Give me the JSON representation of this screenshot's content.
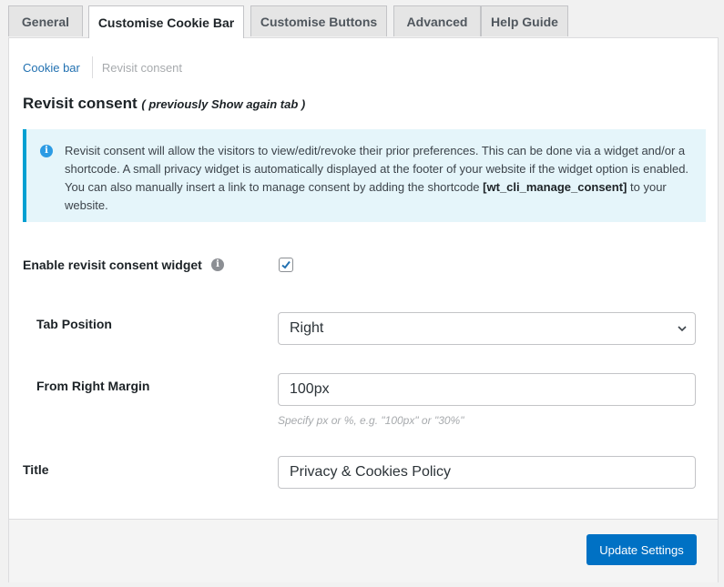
{
  "tabs": [
    {
      "label": "General",
      "active": false
    },
    {
      "label": "Customise Cookie Bar",
      "active": true
    },
    {
      "label": "Customise Buttons",
      "active": false
    },
    {
      "label": "Advanced",
      "active": false
    },
    {
      "label": "Help Guide",
      "active": false
    }
  ],
  "subnav": {
    "items": [
      {
        "label": "Cookie bar",
        "active": false
      },
      {
        "label": "Revisit consent",
        "active": true
      }
    ]
  },
  "section": {
    "title": "Revisit consent",
    "subtitle": "( previously Show again tab )"
  },
  "notice": {
    "icon": "info-icon",
    "text": "Revisit consent will allow the visitors to view/edit/revoke their prior preferences. This can be done via a widget and/or a shortcode. A small privacy widget is automatically displayed at the footer of your website if the widget option is enabled. You can also manually insert a link to manage consent by adding the shortcode",
    "shortcode": "[wt_cli_manage_consent]",
    "text_end": "to your website."
  },
  "form": {
    "enable_widget": {
      "label": "Enable revisit consent widget",
      "checked": true,
      "info_icon": "info-icon"
    },
    "tab_position": {
      "label": "Tab Position",
      "value": "Right"
    },
    "right_margin": {
      "label": "From Right Margin",
      "value": "100px",
      "hint": "Specify px or %, e.g. \"100px\" or \"30%\""
    },
    "title": {
      "label": "Title",
      "value": "Privacy & Cookies Policy"
    }
  },
  "footer": {
    "update_label": "Update Settings"
  },
  "colors": {
    "primary": "#0071c4",
    "link": "#2271b1",
    "notice_bg": "#e5f5fa",
    "notice_border": "#00a0d2"
  }
}
